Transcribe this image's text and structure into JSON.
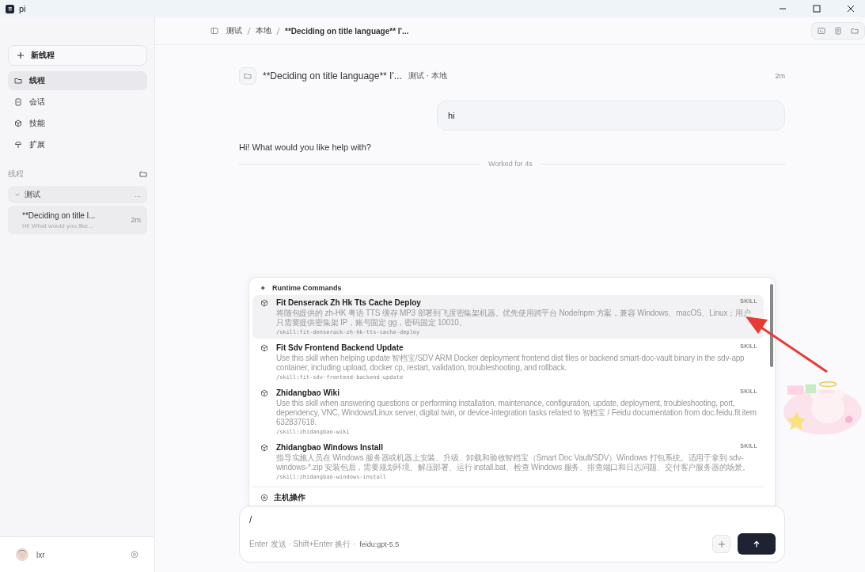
{
  "window": {
    "title": "pi"
  },
  "sidebar": {
    "new_thread": "新线程",
    "nav": [
      {
        "label": "线程",
        "selected": true
      },
      {
        "label": "会话",
        "selected": false
      },
      {
        "label": "技能",
        "selected": false
      },
      {
        "label": "扩展",
        "selected": false
      }
    ],
    "section_title": "线程",
    "groups": [
      {
        "label": "测试",
        "more": "...",
        "expanded": true,
        "children": [
          {
            "title": "**Deciding on title l...",
            "preview": "Hi! What would you like...",
            "time": "2m",
            "selected": true
          }
        ]
      }
    ],
    "user": {
      "name": "lxr"
    }
  },
  "breadcrumb": [
    "测试",
    "本地",
    "**Deciding on title language** I'..."
  ],
  "thread_header": {
    "title": "**Deciding on title language** I'...",
    "meta": "测试 · 本地",
    "time": "2m"
  },
  "user_message": "hi",
  "assistant_message": "Hi! What would you like help with?",
  "worked": "Worked for 4s",
  "command_menu": {
    "section": "Runtime Commands",
    "items": [
      {
        "title": "Fit Denserack Zh Hk Tts Cache Deploy",
        "tag": "SKILL",
        "description": "将随包提供的 zh-HK 粤语 TTS 缓存 MP3 部署到飞度密集架机器。优先使用跨平台 Node/npm 方案，兼容 Windows、macOS、Linux；用户只需要提供密集架 IP，账号固定 gg，密码固定 10010。",
        "command": "/skill:fit-denserack-zh-hk-tts-cache-deploy",
        "selected": true
      },
      {
        "title": "Fit Sdv Frontend Backend Update",
        "tag": "SKILL",
        "description": "Use this skill when helping update 智档宝/SDV ARM Docker deployment frontend dist files or backend smart-doc-vault binary in the sdv-app container, including upload, docker cp, restart, validation, troubleshooting, and rollback.",
        "command": "/skill:fit-sdv-frontend-backend-update",
        "selected": false
      },
      {
        "title": "Zhidangbao Wiki",
        "tag": "SKILL",
        "description": "Use this skill when answering questions or performing installation, maintenance, configuration, update, deployment, troubleshooting, port, dependency, VNC, Windows/Linux server, digital twin, or device-integration tasks related to 智档宝 / Feidu documentation from doc.feidu.fit item 632837618.",
        "command": "/skill:zhidangbao-wiki",
        "selected": false
      },
      {
        "title": "Zhidangbao Windows Install",
        "tag": "SKILL",
        "description": "指导实施人员在 Windows 服务器或机器上安装、升级、卸载和验收智档宝（Smart Doc Vault/SDV）Windows 打包系统。适用于拿到 sdv-windows-*.zip 安装包后，需要规划环境、解压部署、运行 install.bat、检查 Windows 服务、排查端口和日志问题、交付客户服务器的场景。",
        "command": "/skill:zhidangbao-windows-install",
        "selected": false
      }
    ],
    "next_section": "主机操作"
  },
  "composer": {
    "value": "/",
    "hint": "Enter 发送 · Shift+Enter 换行 ·",
    "model": "feidu:gpt-5.5"
  }
}
